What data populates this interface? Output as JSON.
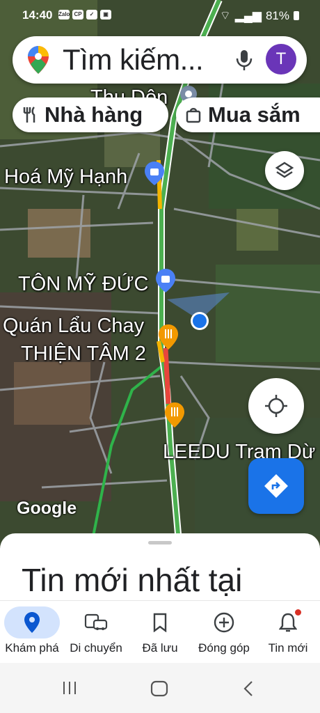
{
  "status_bar": {
    "time": "14:40",
    "battery": "81%",
    "notif_icons": [
      "Zalo",
      "CP"
    ]
  },
  "search": {
    "placeholder": "Tìm kiếm...",
    "avatar_letter": "T"
  },
  "chips": [
    {
      "label": "Nhà hàng",
      "icon": "restaurant-icon"
    },
    {
      "label": "Mua sắm",
      "icon": "shopping-bag-icon"
    }
  ],
  "map": {
    "labels": {
      "thu_don": "Thu Dôn",
      "hoa_my_hanh": "Hoá Mỹ Hạnh",
      "ton_my_duc": "TÔN MỸ ĐỨC",
      "quan_lau_chay": "Quán Lẩu Chay",
      "thien_tam": "THIỆN TÂM 2",
      "leedu": "LEEDU Trạm Dừ"
    },
    "attribution": "Google",
    "colors": {
      "road_traffic": "#4caf50",
      "road_slow": "#f4b400",
      "road_jam": "#e8453c",
      "location_dot": "#1a73e8"
    }
  },
  "sheet": {
    "title": "Tin mới nhất tại"
  },
  "bottom_nav": [
    {
      "label": "Khám phá",
      "icon": "explore-pin-icon",
      "active": true
    },
    {
      "label": "Di chuyển",
      "icon": "commute-icon",
      "active": false
    },
    {
      "label": "Đã lưu",
      "icon": "bookmark-icon",
      "active": false
    },
    {
      "label": "Đóng góp",
      "icon": "add-circle-icon",
      "active": false
    },
    {
      "label": "Tin mới",
      "icon": "bell-icon",
      "active": false
    }
  ]
}
